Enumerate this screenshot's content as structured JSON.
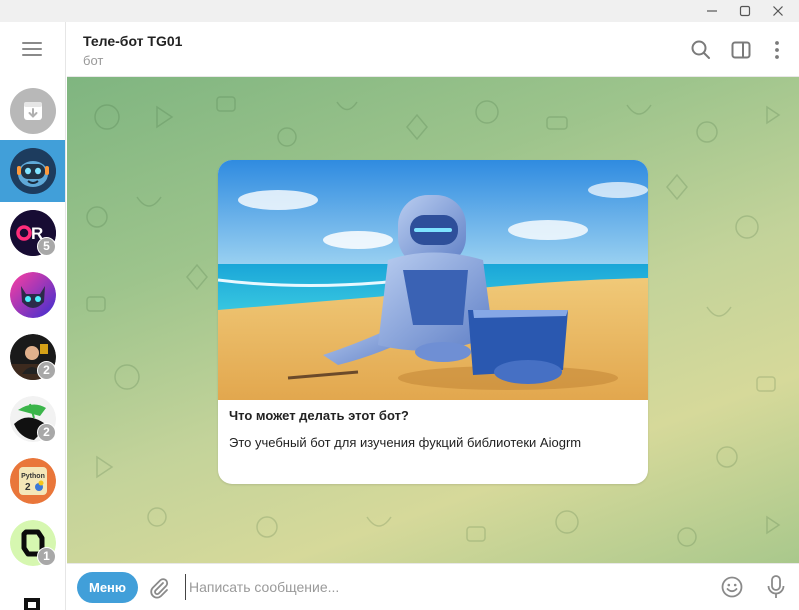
{
  "window": {
    "controls": [
      "minimize-icon",
      "maximize-icon",
      "close-icon"
    ]
  },
  "sidebar": {
    "menu_icon": "hamburger-icon",
    "chats": [
      {
        "id": "archive",
        "icon": "archive-icon",
        "badge": ""
      },
      {
        "id": "tg01-bot",
        "active": true,
        "badge": ""
      },
      {
        "id": "qr-channel",
        "avatar_text": "QR",
        "badge": "5"
      },
      {
        "id": "cat-chat",
        "badge": ""
      },
      {
        "id": "man-chat",
        "badge": "2"
      },
      {
        "id": "bird-chat",
        "badge": "2"
      },
      {
        "id": "python-chat",
        "avatar_text": "Python",
        "badge": ""
      },
      {
        "id": "logo-chat",
        "badge": "1"
      }
    ]
  },
  "header": {
    "title": "Теле-бот TG01",
    "subtitle": "бот",
    "icons": [
      "search-icon",
      "sidebar-toggle-icon",
      "more-icon"
    ]
  },
  "bot_card": {
    "question": "Что может делать этот бот?",
    "description": "Это учебный бот для изучения фукций библиотеки Aiogrm"
  },
  "composer": {
    "menu_label": "Меню",
    "placeholder": "Написать сообщение...",
    "value": "",
    "icons": [
      "attach-icon",
      "emoji-icon",
      "mic-icon"
    ]
  }
}
